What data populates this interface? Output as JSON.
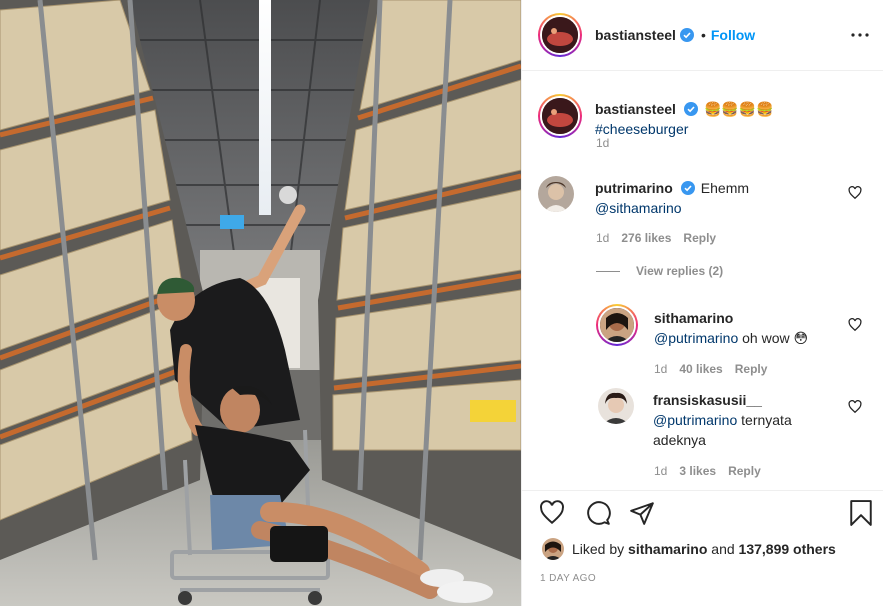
{
  "post_author": {
    "username": "bastiansteel",
    "dot": "•",
    "follow_label": "Follow"
  },
  "caption": {
    "username": "bastiansteel",
    "emoji": "🍔🍔🍔🍔",
    "hashtag": "#cheeseburger",
    "time": "1d"
  },
  "comments": [
    {
      "username": "putrimarino",
      "verified": true,
      "text": "Ehemm",
      "mention": "@sithamarino",
      "time": "1d",
      "likes": "276 likes",
      "reply_label": "Reply",
      "view_replies": "View replies (2)",
      "replies": [
        {
          "username": "sithamarino",
          "mention": "@putrimarino",
          "text": "oh wow 😳",
          "time": "1d",
          "likes": "40 likes",
          "reply_label": "Reply"
        },
        {
          "username": "fransiskasusii__",
          "mention": "@putrimarino",
          "text": "ternyata adeknya",
          "time": "1d",
          "likes": "3 likes",
          "reply_label": "Reply"
        }
      ]
    }
  ],
  "actions": {
    "liked_by_prefix": "Liked by",
    "liked_by_user": "sithamarino",
    "liked_by_middle": "and",
    "liked_by_count": "137,899 others",
    "timestamp": "1 DAY AGO"
  },
  "colors": {
    "link_blue": "#0095f6",
    "verified_blue": "#3897f0",
    "muted": "#8e8e8e"
  },
  "icons": [
    "verified-icon",
    "more-icon",
    "heart-icon",
    "comment-icon",
    "share-icon",
    "bookmark-icon"
  ]
}
